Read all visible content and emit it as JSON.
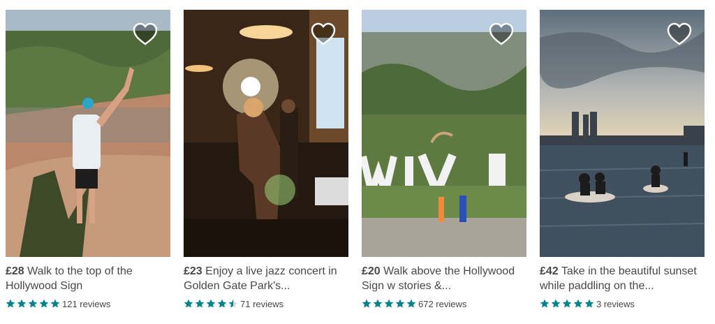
{
  "colors": {
    "star": "#008489",
    "text": "#484848"
  },
  "listings": [
    {
      "price": "£28",
      "title": "Walk to the top of the Hollywood Sign",
      "rating": 5,
      "reviews": "121 reviews",
      "favorite_icon": "heart-outline-icon"
    },
    {
      "price": "£23",
      "title": "Enjoy a live jazz concert in Golden Gate Park's...",
      "rating": 4.5,
      "reviews": "71 reviews",
      "favorite_icon": "heart-outline-icon"
    },
    {
      "price": "£20",
      "title": "Walk above the Hollywood Sign w stories &...",
      "rating": 5,
      "reviews": "672 reviews",
      "favorite_icon": "heart-outline-icon"
    },
    {
      "price": "£42",
      "title": "Take in the beautiful sunset while paddling on the...",
      "rating": 5,
      "reviews": "3 reviews",
      "favorite_icon": "heart-outline-icon"
    }
  ]
}
